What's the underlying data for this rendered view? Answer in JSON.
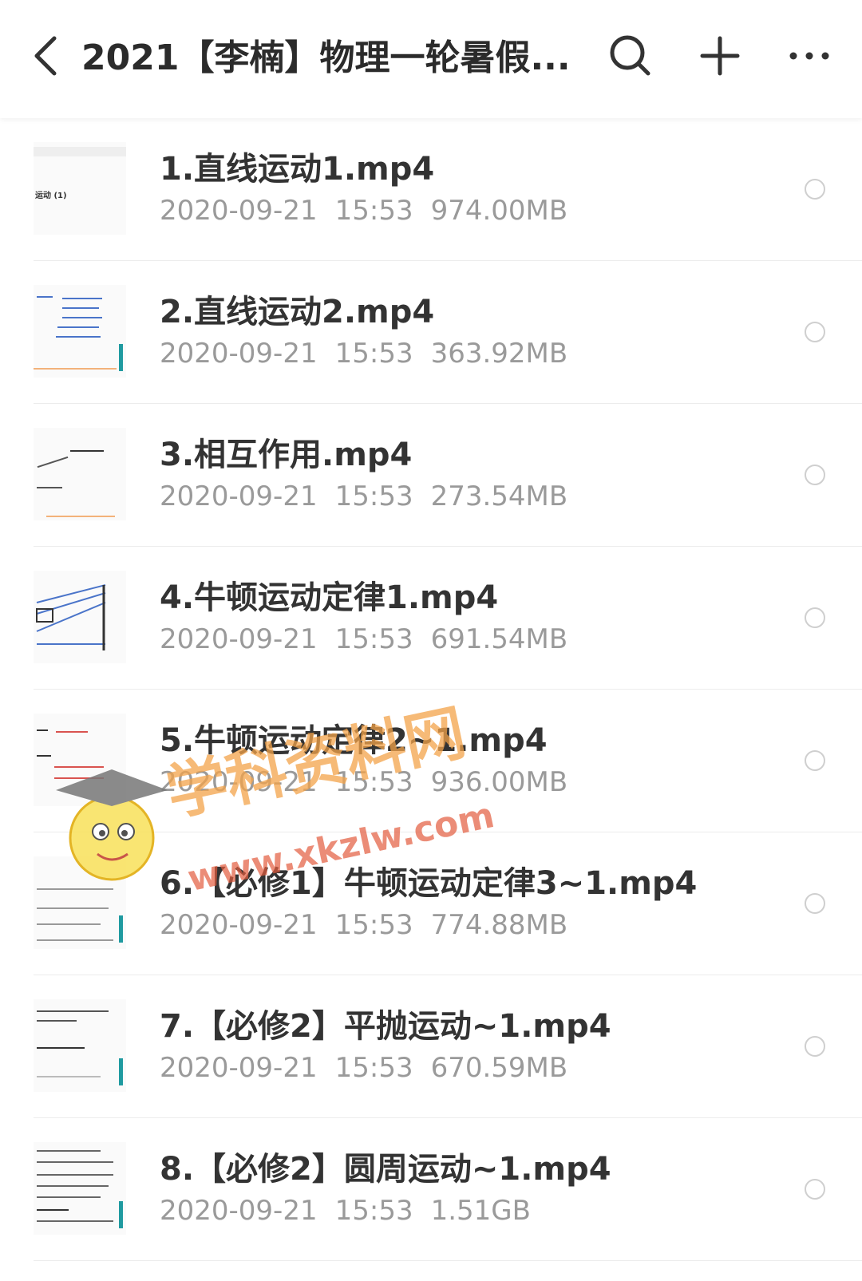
{
  "header": {
    "title": "2021【李楠】物理一轮暑假...",
    "icons": [
      "back-arrow-icon",
      "search-icon",
      "plus-icon",
      "more-icon"
    ]
  },
  "files": [
    {
      "name": "1.直线运动1.mp4",
      "date": "2020-09-21",
      "time": "15:53",
      "size": "974.00MB"
    },
    {
      "name": "2.直线运动2.mp4",
      "date": "2020-09-21",
      "time": "15:53",
      "size": "363.92MB"
    },
    {
      "name": "3.相互作用.mp4",
      "date": "2020-09-21",
      "time": "15:53",
      "size": "273.54MB"
    },
    {
      "name": "4.牛顿运动定律1.mp4",
      "date": "2020-09-21",
      "time": "15:53",
      "size": "691.54MB"
    },
    {
      "name": "5.牛顿运动定律2~1.mp4",
      "date": "2020-09-21",
      "time": "15:53",
      "size": "936.00MB"
    },
    {
      "name": "6.【必修1】牛顿运动定律3~1.mp4",
      "date": "2020-09-21",
      "time": "15:53",
      "size": "774.88MB"
    },
    {
      "name": "7.【必修2】平抛运动~1.mp4",
      "date": "2020-09-21",
      "time": "15:53",
      "size": "670.59MB"
    },
    {
      "name": "8.【必修2】圆周运动~1.mp4",
      "date": "2020-09-21",
      "time": "15:53",
      "size": "1.51GB"
    }
  ],
  "thumb_text": {
    "t1": "运动 (1)"
  },
  "watermark": {
    "text": "学科资料网",
    "url": "www.xkzlw.com"
  },
  "colors": {
    "accent": "#1f9aa0",
    "title": "#333333",
    "meta": "#9a9a9a"
  }
}
